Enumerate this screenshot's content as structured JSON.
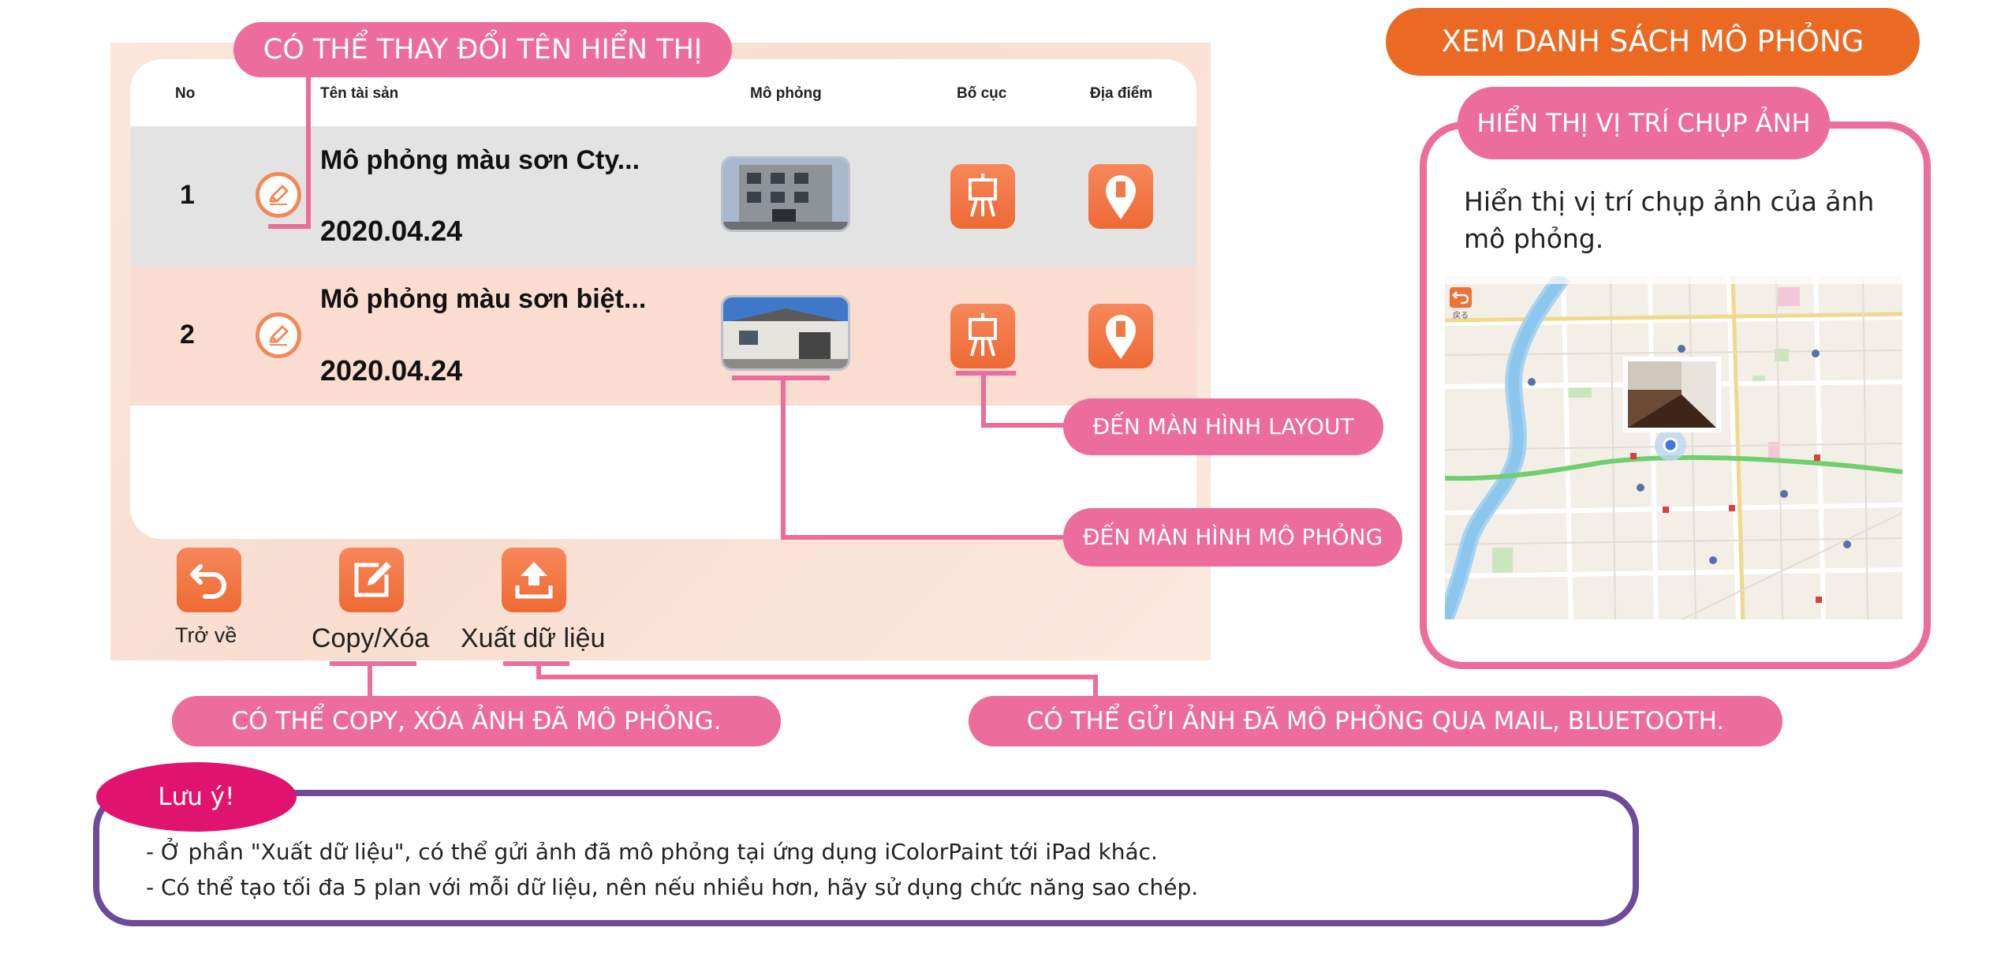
{
  "table": {
    "headers": {
      "no": "No",
      "name": "Tên tài sản",
      "sim": "Mô phỏng",
      "layout": "Bố cục",
      "location": "Địa điểm"
    },
    "rows": [
      {
        "no": "1",
        "name": "Mô phỏng màu sơn Cty...",
        "date": "2020.04.24"
      },
      {
        "no": "2",
        "name": "Mô phỏng màu sơn biệt...",
        "date": "2020.04.24"
      }
    ]
  },
  "toolbar": {
    "back": "Trở về",
    "copy": "Copy/Xóa",
    "export": "Xuất dữ liệu"
  },
  "callouts": {
    "rename": "CÓ THỂ THAY ĐỔI TÊN HIỂN THỊ",
    "to_layout": "ĐẾN MÀN HÌNH LAYOUT",
    "to_simulation": "ĐẾN MÀN HÌNH MÔ PHỎNG",
    "copy_delete": "CÓ THỂ COPY, XÓA ẢNH ĐÃ MÔ PHỎNG.",
    "send": "CÓ THỂ GỬI ẢNH ĐÃ MÔ PHỎNG QUA MAIL, BLUETOOTH."
  },
  "right_panel": {
    "header": "XEM DANH SÁCH MÔ PHỎNG",
    "title": "HIỂN THỊ VỊ TRÍ CHỤP ẢNH",
    "description": "Hiển thị vị trí chụp ảnh của ảnh mô phỏng.",
    "map_back_label": "戻る"
  },
  "note": {
    "badge": "Lưu ý!",
    "lines": [
      "- Ở phần \"Xuất dữ liệu\", có thể gửi ảnh đã mô phỏng tại ứng dụng iColorPaint tới iPad khác.",
      "- Có thể tạo tối đa 5 plan với mỗi dữ liệu, nên nếu nhiều hơn, hãy sử dụng chức năng sao chép."
    ]
  },
  "colors": {
    "pink": "#ec6d9b",
    "orange": "#ea6a23",
    "purple": "#6b4b9a",
    "magenta": "#e0146e"
  },
  "icons": [
    "pencil-icon",
    "easel-icon",
    "map-pin-icon",
    "back-arrow-icon",
    "edit-icon",
    "upload-icon"
  ]
}
